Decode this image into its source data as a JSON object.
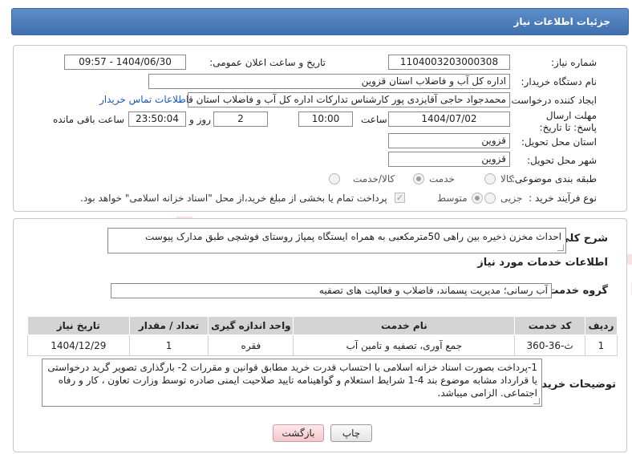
{
  "title": "جزئیات اطلاعات نیاز",
  "watermark_text": "AriaTender.neT",
  "fields": {
    "need_number_label": "شماره نیاز:",
    "need_number": "1104003203000308",
    "announce_label": "تاریخ و ساعت اعلان عمومی:",
    "announce_value": "1404/06/30 - 09:57",
    "buyer_org_label": "نام دستگاه خریدار:",
    "buyer_org": "اداره کل آب و فاضلاب استان قزوین",
    "creator_label": "ایجاد کننده درخواست:",
    "creator": "محمدجواد حاجی آقایزدی پور کارشناس تدارکات اداره کل آب و فاضلاب استان قزوین",
    "contact_link": "اطلاعات تماس خریدار",
    "deadline_label": "مهلت ارسال پاسخ: تا تاریخ:",
    "deadline_date": "1404/07/02",
    "time_label": "ساعت",
    "deadline_time": "10:00",
    "days_value": "2",
    "days_label": "روز و",
    "remaining_time": "23:50:04",
    "remaining_label": "ساعت باقی مانده",
    "province_label": "استان محل تحویل:",
    "province": "قزوین",
    "city_label": "شهر محل تحویل:",
    "city": "قزوین",
    "category_label": "طبقه بندی موضوعی:",
    "category_options": [
      "کالا",
      "خدمت",
      "کالا/خدمت"
    ],
    "category_selected": "خدمت",
    "process_label": "نوع فرآیند خرید :",
    "process_options": [
      "جزیی",
      "متوسط"
    ],
    "process_selected": "متوسط",
    "payment_note": "پرداخت تمام یا بخشی از مبلغ خرید،از محل \"اسناد خزانه اسلامی\" خواهد بود."
  },
  "description": {
    "label": "شرح کلی نیاز:",
    "text": "احداث مخزن ذخیره بین راهی 50مترمکعبی به همراه ایستگاه پمپاژ روستای فوشچی طبق مدارک پیوست"
  },
  "services": {
    "heading": "اطلاعات خدمات مورد نیاز",
    "group_label": "گروه خدمت:",
    "group_value": "آب رسانی؛ مدیریت پسماند، فاضلاب و فعالیت های تصفیه",
    "columns": [
      "ردیف",
      "کد خدمت",
      "نام خدمت",
      "واحد اندازه گیری",
      "تعداد / مقدار",
      "تاریخ نیاز"
    ],
    "rows": [
      [
        "1",
        "ث-36-360",
        "جمع آوری، تصفیه و تامین آب",
        "فقره",
        "1",
        "1404/12/29"
      ]
    ]
  },
  "buyer_notes": {
    "label": "توضیحات خریدار:",
    "text": "1-پرداخت بصورت اسناد خزانه اسلامی با احتساب قدرت خرید مطابق قوانین و مقررات 2- بارگذاری تصویر گرید درخواستی یا قرارداد مشابه موضوع بند 4-1 شرایط استعلام و گواهینامه تایید صلاحیت ایمنی صادره توسط وزارت تعاون ، کار و رفاه اجتماعی. الزامی میباشد."
  },
  "buttons": {
    "print": "چاپ",
    "back": "بازگشت"
  },
  "colors": {
    "title_bar": "#4a7bb9",
    "link": "#1a56b8",
    "table_header": "#d4d4d4",
    "back_button": "#f4c6cb"
  }
}
